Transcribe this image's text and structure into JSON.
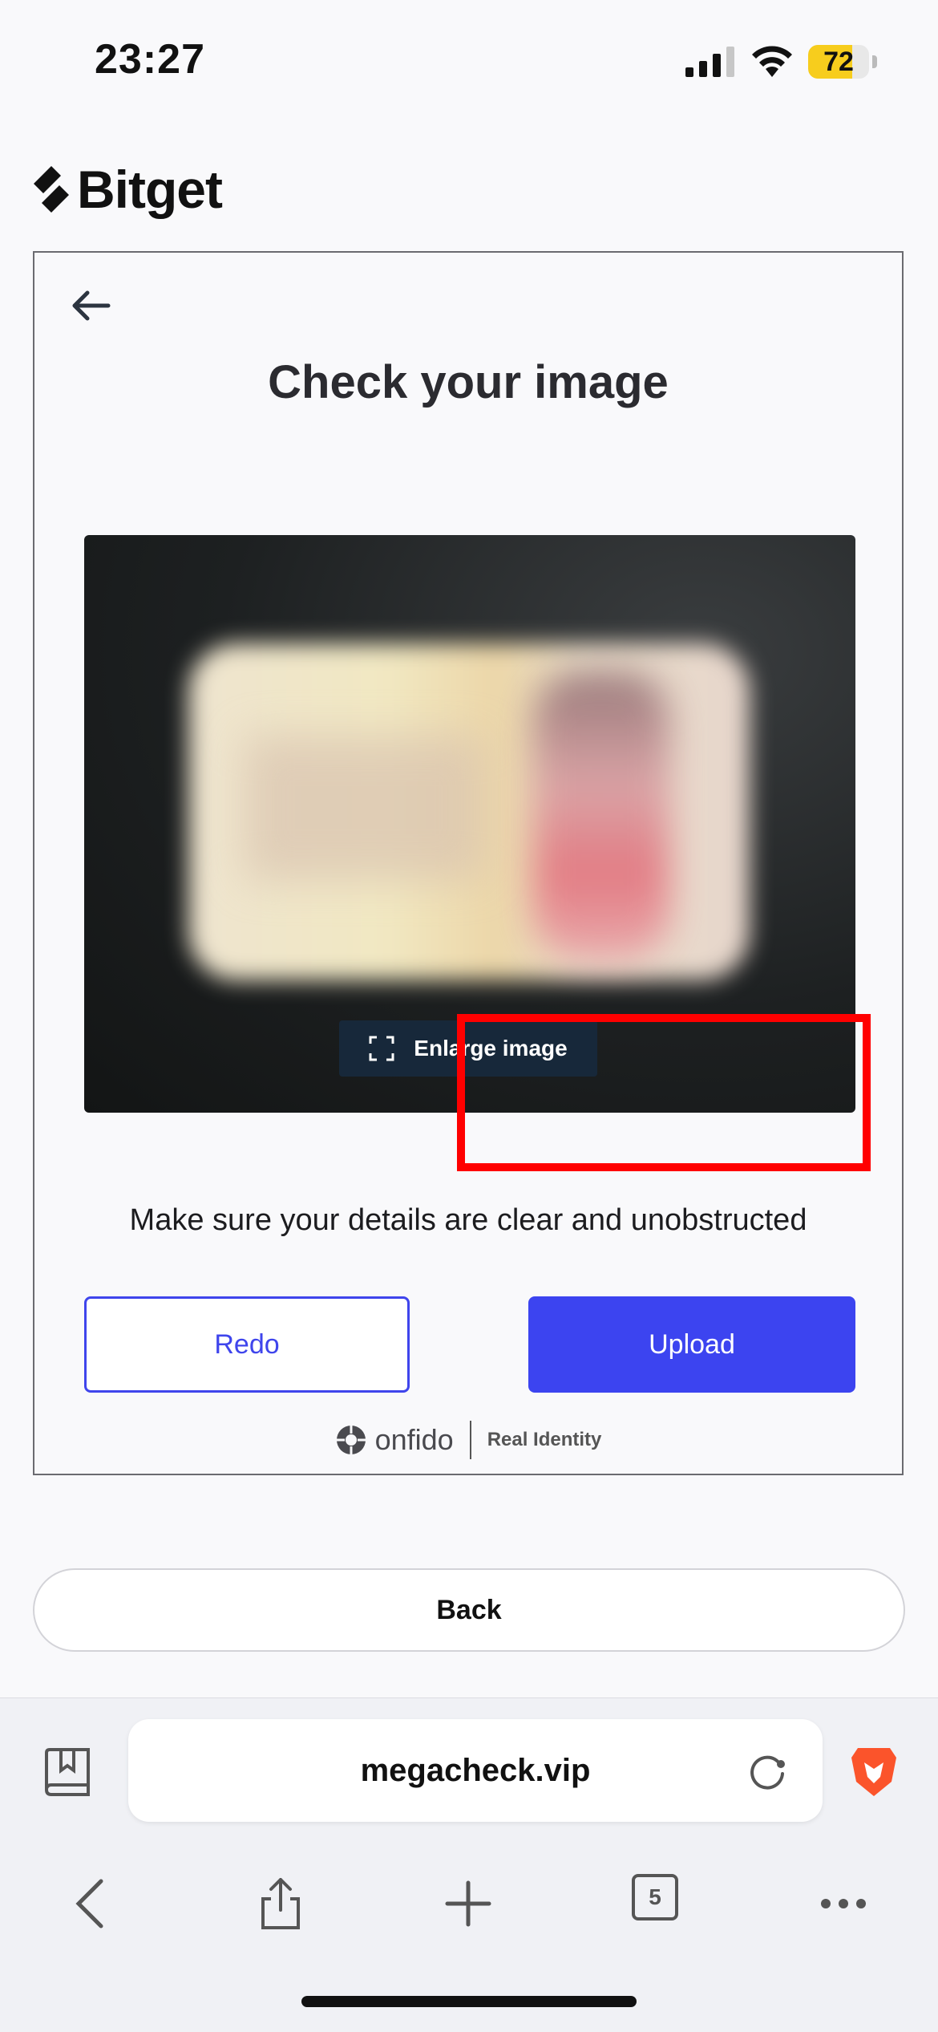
{
  "status_bar": {
    "time": "23:27",
    "battery_percent": "72",
    "battery_level": 0.72
  },
  "brand": {
    "name": "Bitget"
  },
  "verification": {
    "title": "Check your image",
    "enlarge_label": "Enlarge image",
    "hint": "Make sure your details are clear and unobstructed",
    "redo_label": "Redo",
    "upload_label": "Upload",
    "provider_name": "onfido",
    "provider_tagline": "Real Identity"
  },
  "page": {
    "back_label": "Back"
  },
  "browser": {
    "url": "megacheck.vip",
    "tab_count": "5"
  },
  "colors": {
    "primary": "#3c44f0",
    "highlight": "#ff0000"
  },
  "icons": [
    "back-arrow-icon",
    "expand-icon",
    "bookmarks-icon",
    "reload-icon",
    "brave-lion-icon",
    "chevron-left-icon",
    "share-icon",
    "plus-icon",
    "tabs-icon",
    "more-icon"
  ]
}
